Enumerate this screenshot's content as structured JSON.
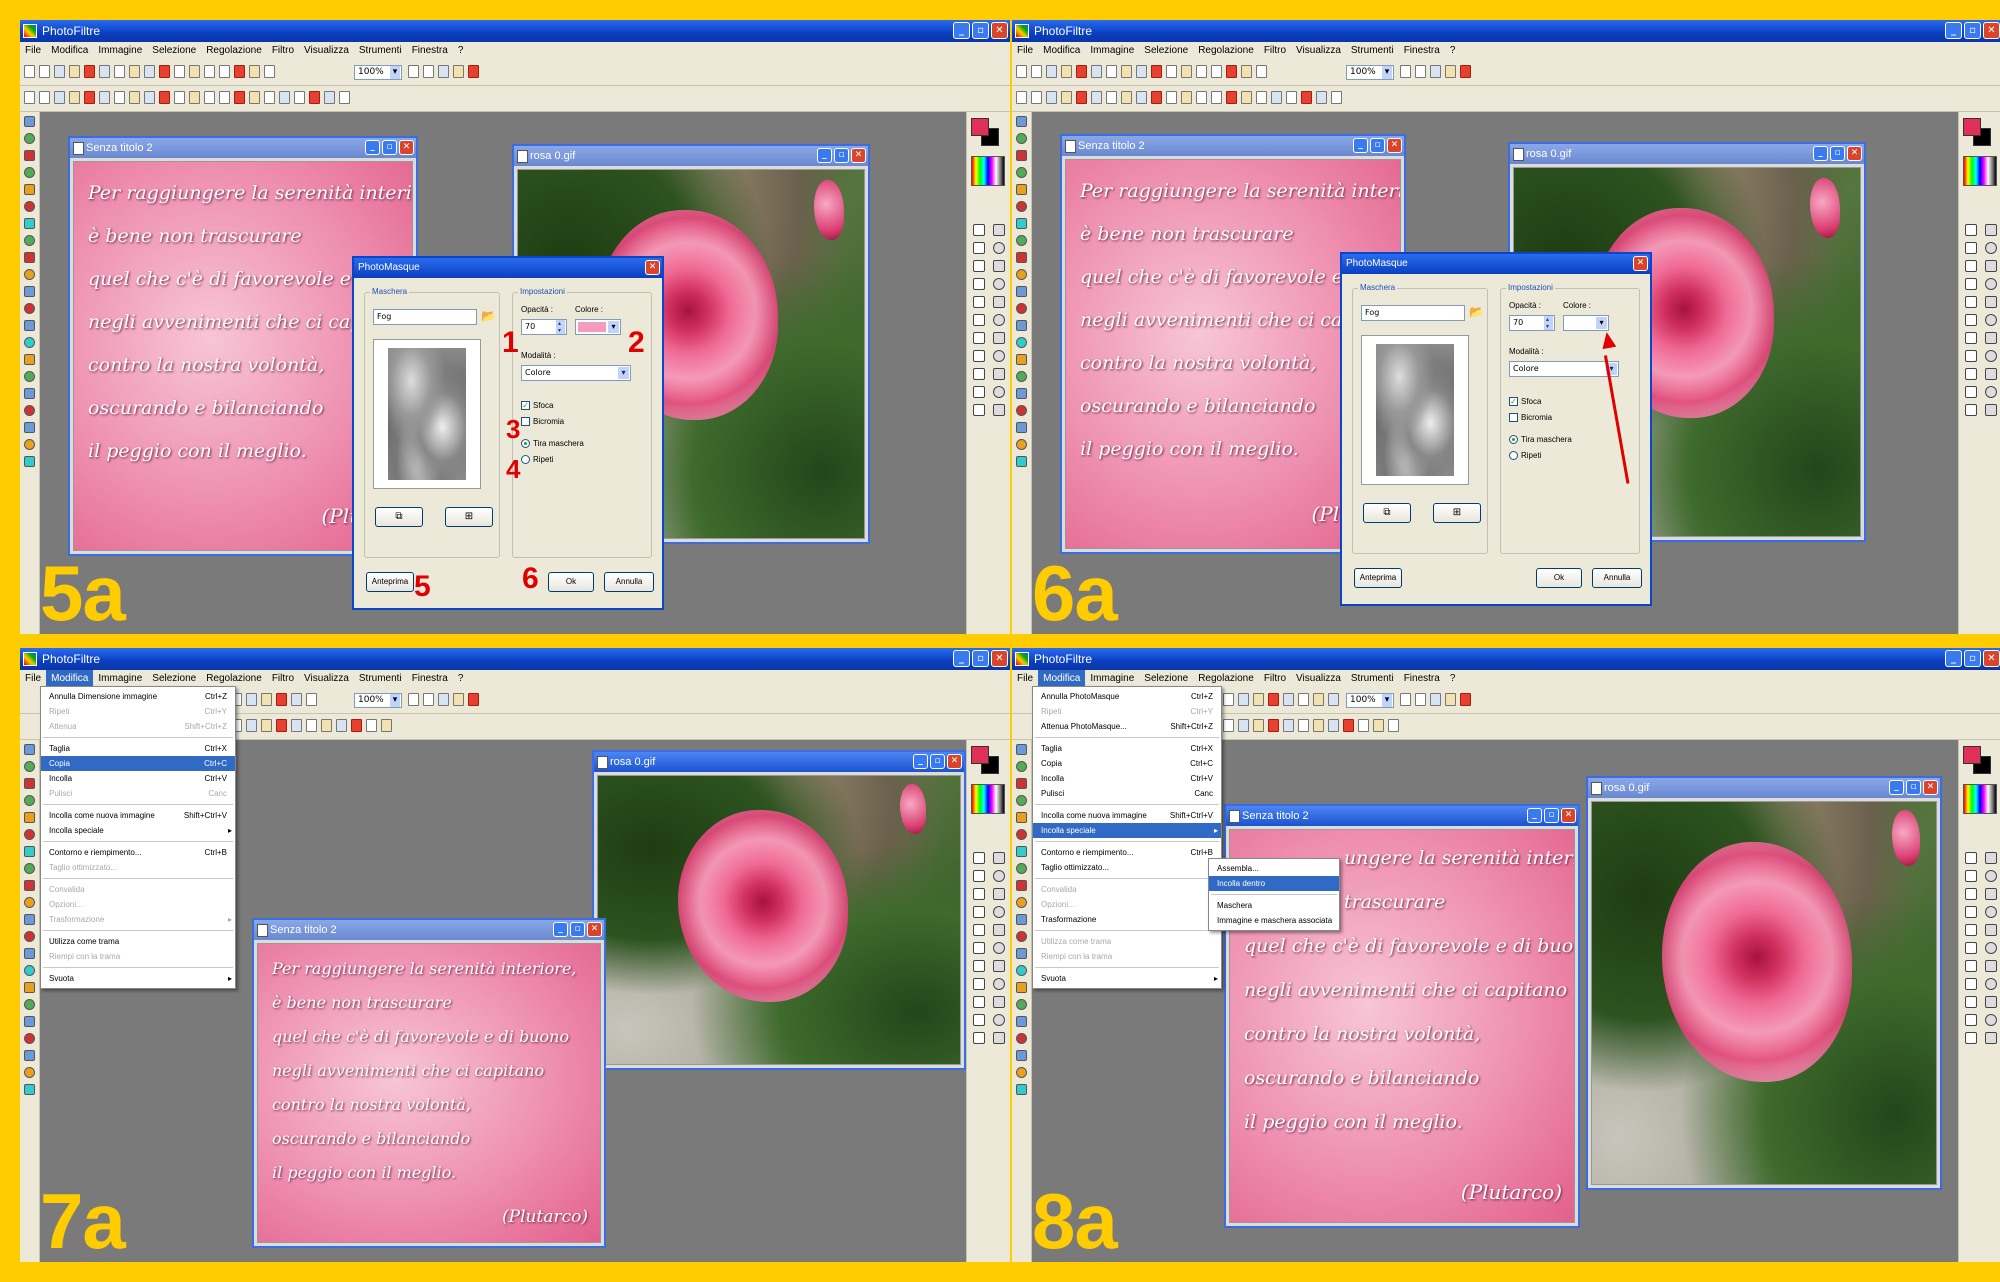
{
  "app": {
    "title": "PhotoFiltre",
    "zoom": "100%",
    "menus": [
      "File",
      "Modifica",
      "Immagine",
      "Selezione",
      "Regolazione",
      "Filtro",
      "Visualizza",
      "Strumenti",
      "Finestra",
      "?"
    ]
  },
  "windows": {
    "doc_title": "Senza titolo 2",
    "photo_title": "rosa 0.gif"
  },
  "poem": {
    "lines": [
      "Per raggiungere la serenità interiore,",
      "è bene non trascurare",
      "quel che c'è di favorevole e di buono",
      "negli avvenimenti che ci capitano",
      "contro la nostra volontà,",
      "oscurando e bilanciando",
      "il peggio con il meglio."
    ],
    "line3_short": "quel che c'è di favorevole e di bu",
    "line4_short": "negli avvenimenti che ci capitan",
    "line3_mid": "quel che c'è di favorevole e di b",
    "line4_mid": "negli avvenimenti che ci capitan",
    "line1_cut": "ungere la serenità interiore,",
    "line2_cut": "trascurare",
    "signature": "(Plutarco)",
    "signature_cut": "(Plu"
  },
  "dialog": {
    "title": "PhotoMasque",
    "group_mask": "Maschera",
    "group_settings": "Impostazioni",
    "mask_name": "Fog",
    "opacity_label": "Opacità :",
    "opacity_value": "70",
    "color_label": "Colore :",
    "mode_label": "Modalità :",
    "mode_value": "Colore",
    "blur_label": "Sfoca",
    "bicolor_label": "Bicromia",
    "stretch_label": "Tira maschera",
    "repeat_label": "Ripeti",
    "preview_button": "Anteprima",
    "ok_button": "Ok",
    "cancel_button": "Annulla",
    "color_5a": "#f49bc0",
    "color_6a": "#ffffff"
  },
  "markers": {
    "n1": "1",
    "n2": "2",
    "n3": "3",
    "n4": "4",
    "n5": "5",
    "n6": "6",
    "step5a": "5a",
    "step6a": "6a",
    "step7a": "7a",
    "step8a": "8a"
  },
  "edit_menu_7a": [
    {
      "label": "Annulla Dimensione immagine",
      "shortcut": "Ctrl+Z",
      "state": "normal"
    },
    {
      "label": "Ripeti",
      "shortcut": "Ctrl+Y",
      "state": "disabled"
    },
    {
      "label": "Attenua",
      "shortcut": "Shift+Ctrl+Z",
      "state": "disabled"
    },
    {
      "sep": true
    },
    {
      "label": "Taglia",
      "shortcut": "Ctrl+X",
      "state": "normal"
    },
    {
      "label": "Copia",
      "shortcut": "Ctrl+C",
      "state": "highlight"
    },
    {
      "label": "Incolla",
      "shortcut": "Ctrl+V",
      "state": "normal"
    },
    {
      "label": "Pulisci",
      "shortcut": "Canc",
      "state": "disabled"
    },
    {
      "sep": true
    },
    {
      "label": "Incolla come nuova immagine",
      "shortcut": "Shift+Ctrl+V",
      "state": "normal"
    },
    {
      "label": "Incolla speciale",
      "shortcut": "",
      "state": "submenu"
    },
    {
      "sep": true
    },
    {
      "label": "Contorno e riempimento...",
      "shortcut": "Ctrl+B",
      "state": "normal"
    },
    {
      "label": "Taglio ottimizzato...",
      "shortcut": "",
      "state": "disabled"
    },
    {
      "sep": true
    },
    {
      "label": "Convalida",
      "shortcut": "",
      "state": "disabled"
    },
    {
      "label": "Opzioni...",
      "shortcut": "",
      "state": "disabled"
    },
    {
      "label": "Trasformazione",
      "shortcut": "",
      "state": "disabled-sub"
    },
    {
      "sep": true
    },
    {
      "label": "Utilizza come trama",
      "shortcut": "",
      "state": "normal"
    },
    {
      "label": "Riempi con la trama",
      "shortcut": "",
      "state": "disabled"
    },
    {
      "sep": true
    },
    {
      "label": "Svuota",
      "shortcut": "",
      "state": "submenu"
    }
  ],
  "edit_menu_8a": [
    {
      "label": "Annulla PhotoMasque",
      "shortcut": "Ctrl+Z",
      "state": "normal"
    },
    {
      "label": "Ripeti",
      "shortcut": "Ctrl+Y",
      "state": "disabled"
    },
    {
      "label": "Attenua PhotoMasque...",
      "shortcut": "Shift+Ctrl+Z",
      "state": "normal"
    },
    {
      "sep": true
    },
    {
      "label": "Taglia",
      "shortcut": "Ctrl+X",
      "state": "normal"
    },
    {
      "label": "Copia",
      "shortcut": "Ctrl+C",
      "state": "normal"
    },
    {
      "label": "Incolla",
      "shortcut": "Ctrl+V",
      "state": "normal"
    },
    {
      "label": "Pulisci",
      "shortcut": "Canc",
      "state": "normal"
    },
    {
      "sep": true
    },
    {
      "label": "Incolla come nuova immagine",
      "shortcut": "Shift+Ctrl+V",
      "state": "normal"
    },
    {
      "label": "Incolla speciale",
      "shortcut": "",
      "state": "highlight-sub"
    },
    {
      "sep": true
    },
    {
      "label": "Contorno e riempimento...",
      "shortcut": "Ctrl+B",
      "state": "normal"
    },
    {
      "label": "Taglio ottimizzato...",
      "shortcut": "",
      "state": "normal"
    },
    {
      "sep": true
    },
    {
      "label": "Convalida",
      "shortcut": "",
      "state": "disabled"
    },
    {
      "label": "Opzioni...",
      "shortcut": "",
      "state": "disabled"
    },
    {
      "label": "Trasformazione",
      "shortcut": "",
      "state": "submenu"
    },
    {
      "sep": true
    },
    {
      "label": "Utilizza come trama",
      "shortcut": "",
      "state": "disabled"
    },
    {
      "label": "Riempi con la trama",
      "shortcut": "",
      "state": "disabled"
    },
    {
      "sep": true
    },
    {
      "label": "Svuota",
      "shortcut": "",
      "state": "submenu"
    }
  ],
  "paste_special_submenu": [
    {
      "label": "Assembla...",
      "state": "normal"
    },
    {
      "label": "Incolla dentro",
      "state": "highlight"
    },
    {
      "sep": true
    },
    {
      "label": "Maschera",
      "state": "normal"
    },
    {
      "label": "Immagine e maschera associata",
      "state": "normal"
    }
  ]
}
